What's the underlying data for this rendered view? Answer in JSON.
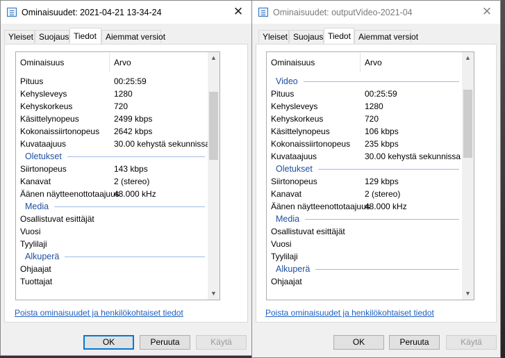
{
  "windows": [
    {
      "title": "Ominaisuudet: 2021-04-21 13-34-24",
      "close_glyph": "✕",
      "tabs": [
        "Yleiset",
        "Suojaus",
        "Tiedot",
        "Aiemmat versiot"
      ],
      "active_tab": "Tiedot",
      "columns": {
        "name": "Ominaisuus",
        "value": "Arvo"
      },
      "rows": [
        {
          "key": "Pituus",
          "value": "00:25:59"
        },
        {
          "key": "Kehysleveys",
          "value": "1280"
        },
        {
          "key": "Kehyskorkeus",
          "value": "720"
        },
        {
          "key": "Käsittelynopeus",
          "value": "2499 kbps"
        },
        {
          "key": "Kokonaissiirtonopeus",
          "value": "2642 kbps"
        },
        {
          "key": "Kuvataajuus",
          "value": "30.00 kehystä sekunnissa"
        },
        {
          "group": "Oletukset"
        },
        {
          "key": "Siirtonopeus",
          "value": "143 kbps"
        },
        {
          "key": "Kanavat",
          "value": "2 (stereo)"
        },
        {
          "key": "Äänen näytteenottotaajuus",
          "value": "48.000 kHz"
        },
        {
          "group": "Media"
        },
        {
          "key": "Osallistuvat esittäjät",
          "value": ""
        },
        {
          "key": "Vuosi",
          "value": ""
        },
        {
          "key": "Tyylilaji",
          "value": ""
        },
        {
          "group": "Alkuperä"
        },
        {
          "key": "Ohjaajat",
          "value": ""
        },
        {
          "key": "Tuottajat",
          "value": ""
        }
      ],
      "link": "Poista ominaisuudet ja henkilökohtaiset tiedot",
      "buttons": {
        "ok": "OK",
        "cancel": "Peruuta",
        "apply": "Käytä"
      }
    },
    {
      "title": "Ominaisuudet: outputVideo-2021-04",
      "close_glyph": "✕",
      "tabs": [
        "Yleiset",
        "Suojaus",
        "Tiedot",
        "Aiemmat versiot"
      ],
      "active_tab": "Tiedot",
      "columns": {
        "name": "Ominaisuus",
        "value": "Arvo"
      },
      "rows": [
        {
          "group": "Video"
        },
        {
          "key": "Pituus",
          "value": "00:25:59"
        },
        {
          "key": "Kehysleveys",
          "value": "1280"
        },
        {
          "key": "Kehyskorkeus",
          "value": "720"
        },
        {
          "key": "Käsittelynopeus",
          "value": "106 kbps"
        },
        {
          "key": "Kokonaissiirtonopeus",
          "value": "235 kbps"
        },
        {
          "key": "Kuvataajuus",
          "value": "30.00 kehystä sekunnissa"
        },
        {
          "group": "Oletukset"
        },
        {
          "key": "Siirtonopeus",
          "value": "129 kbps"
        },
        {
          "key": "Kanavat",
          "value": "2 (stereo)"
        },
        {
          "key": "Äänen näytteenottotaajuus",
          "value": "48.000 kHz"
        },
        {
          "group": "Media"
        },
        {
          "key": "Osallistuvat esittäjät",
          "value": ""
        },
        {
          "key": "Vuosi",
          "value": ""
        },
        {
          "key": "Tyylilaji",
          "value": ""
        },
        {
          "group": "Alkuperä"
        },
        {
          "key": "Ohjaajat",
          "value": ""
        }
      ],
      "link": "Poista ominaisuudet ja henkilökohtaiset tiedot",
      "buttons": {
        "ok": "OK",
        "cancel": "Peruuta",
        "apply": "Käytä"
      }
    }
  ],
  "colors": {
    "link": "#1f5fbf",
    "group_header": "#1e4fa0",
    "default_button_border": "#0078d7"
  }
}
